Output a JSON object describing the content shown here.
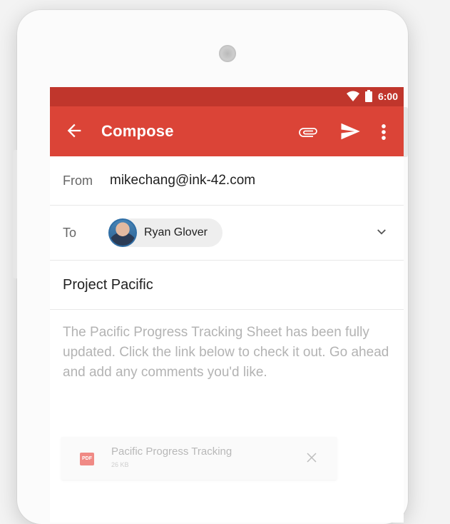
{
  "status": {
    "time": "6:00"
  },
  "appbar": {
    "title": "Compose"
  },
  "from": {
    "label": "From",
    "value": "mikechang@ink-42.com"
  },
  "to": {
    "label": "To",
    "recipient": "Ryan Glover"
  },
  "subject": "Project Pacific",
  "body": "The Pacific Progress Tracking Sheet has been fully updated. Click the link below to check it out. Go ahead and add any comments you'd like.",
  "attachment": {
    "name": "Pacific Progress Tracking",
    "size": "26 KB",
    "type_label": "PDF"
  },
  "colors": {
    "status_bar": "#c0362c",
    "app_bar": "#db4437"
  },
  "icons": [
    "wifi-icon",
    "battery-icon",
    "back-arrow-icon",
    "attach-icon",
    "send-icon",
    "more-vert-icon",
    "chevron-down-icon",
    "close-icon"
  ]
}
